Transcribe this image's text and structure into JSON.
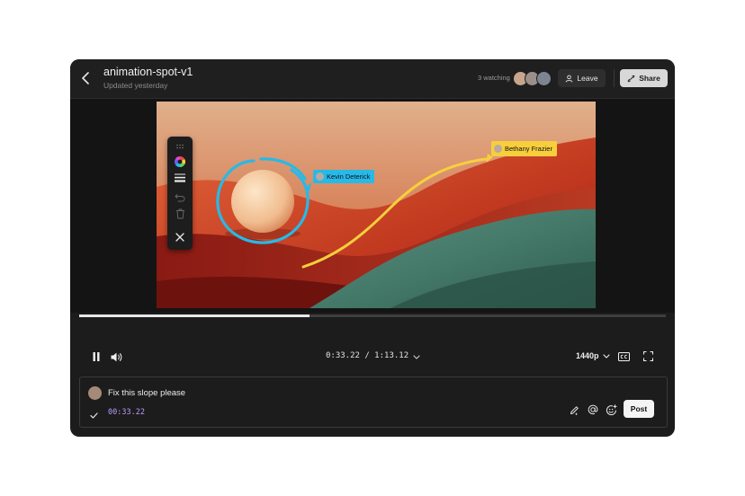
{
  "header": {
    "title": "animation-spot-v1",
    "subtitle": "Updated yesterday",
    "watching": "3 watching",
    "leave_label": "Leave",
    "share_label": "Share",
    "avatar_colors": [
      "#c9a58e",
      "#9c8f8a",
      "#7d8591"
    ]
  },
  "video": {
    "annotations": [
      {
        "name": "Kevin Deterick",
        "color": "#27b9e8"
      },
      {
        "name": "Bethany Frazier",
        "color": "#f7cf3d"
      }
    ]
  },
  "toolbar": {
    "tools": [
      "drag-handle-icon",
      "color-wheel-icon",
      "stroke-width-icon",
      "undo-icon",
      "trash-icon",
      "close-icon"
    ]
  },
  "player": {
    "progress": 0.392,
    "timecode": "0:33.22 / 1:13.12",
    "quality": "1440p"
  },
  "comment": {
    "text": "Fix this slope please",
    "timestamp": "00:33.22",
    "post_label": "Post"
  }
}
